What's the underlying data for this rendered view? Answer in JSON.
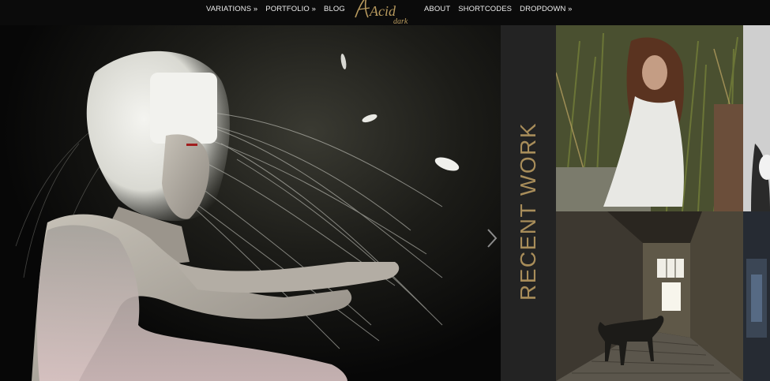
{
  "nav": {
    "left": [
      {
        "label": "VARIATIONS »"
      },
      {
        "label": "PORTFOLIO »"
      },
      {
        "label": "BLOG"
      }
    ],
    "right": [
      {
        "label": "ABOUT"
      },
      {
        "label": "SHORTCODES"
      },
      {
        "label": "DROPDOWN »"
      }
    ]
  },
  "logo": {
    "text": "Acid",
    "subtext": "dark"
  },
  "recent": {
    "label": "RECENT WORK"
  },
  "colors": {
    "accent": "#a88d5a",
    "background": "#000000",
    "panel": "#232323"
  }
}
